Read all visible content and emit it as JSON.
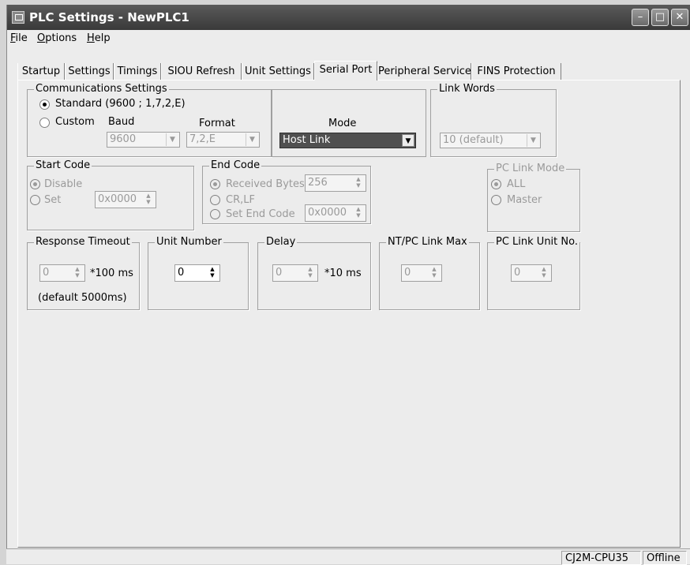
{
  "window": {
    "title": "PLC Settings - NewPLC1"
  },
  "menu": [
    {
      "label": "File",
      "hot": "F",
      "rest": "ile"
    },
    {
      "label": "Options",
      "hot": "O",
      "rest": "ptions"
    },
    {
      "label": "Help",
      "hot": "H",
      "rest": "elp"
    }
  ],
  "tabs": [
    "Startup",
    "Settings",
    "Timings",
    "SIOU Refresh",
    "Unit Settings",
    "Serial Port",
    "Peripheral Service",
    "FINS Protection"
  ],
  "active_tab": "Serial Port",
  "comms": {
    "label": "Communications Settings",
    "standard": "Standard (9600 ; 1,7,2,E)",
    "custom": "Custom",
    "baud_label": "Baud",
    "baud_value": "9600",
    "format_label": "Format",
    "format_value": "7,2,E",
    "mode_label": "Mode",
    "mode_value": "Host Link"
  },
  "link_words": {
    "label": "Link Words",
    "value": "10 (default)"
  },
  "start_code": {
    "label": "Start Code",
    "disable": "Disable",
    "set": "Set",
    "value": "0x0000"
  },
  "end_code": {
    "label": "End Code",
    "received": "Received Bytes",
    "received_value": "256",
    "crlf": "CR,LF",
    "set_end": "Set End Code",
    "set_end_value": "0x0000"
  },
  "pc_link_mode": {
    "label": "PC Link Mode",
    "all": "ALL",
    "master": "Master"
  },
  "response_timeout": {
    "label": "Response Timeout",
    "value": "0",
    "unit": "*100 ms",
    "default_note": "(default 5000ms)"
  },
  "unit_number": {
    "label": "Unit Number",
    "value": "0"
  },
  "delay": {
    "label": "Delay",
    "value": "0",
    "unit": "*10 ms"
  },
  "nt_pc_link_max": {
    "label": "NT/PC Link Max",
    "value": "0"
  },
  "pc_link_unit_no": {
    "label": "PC Link Unit No.",
    "value": "0"
  },
  "status": {
    "model": "CJ2M-CPU35",
    "state": "Offline"
  }
}
